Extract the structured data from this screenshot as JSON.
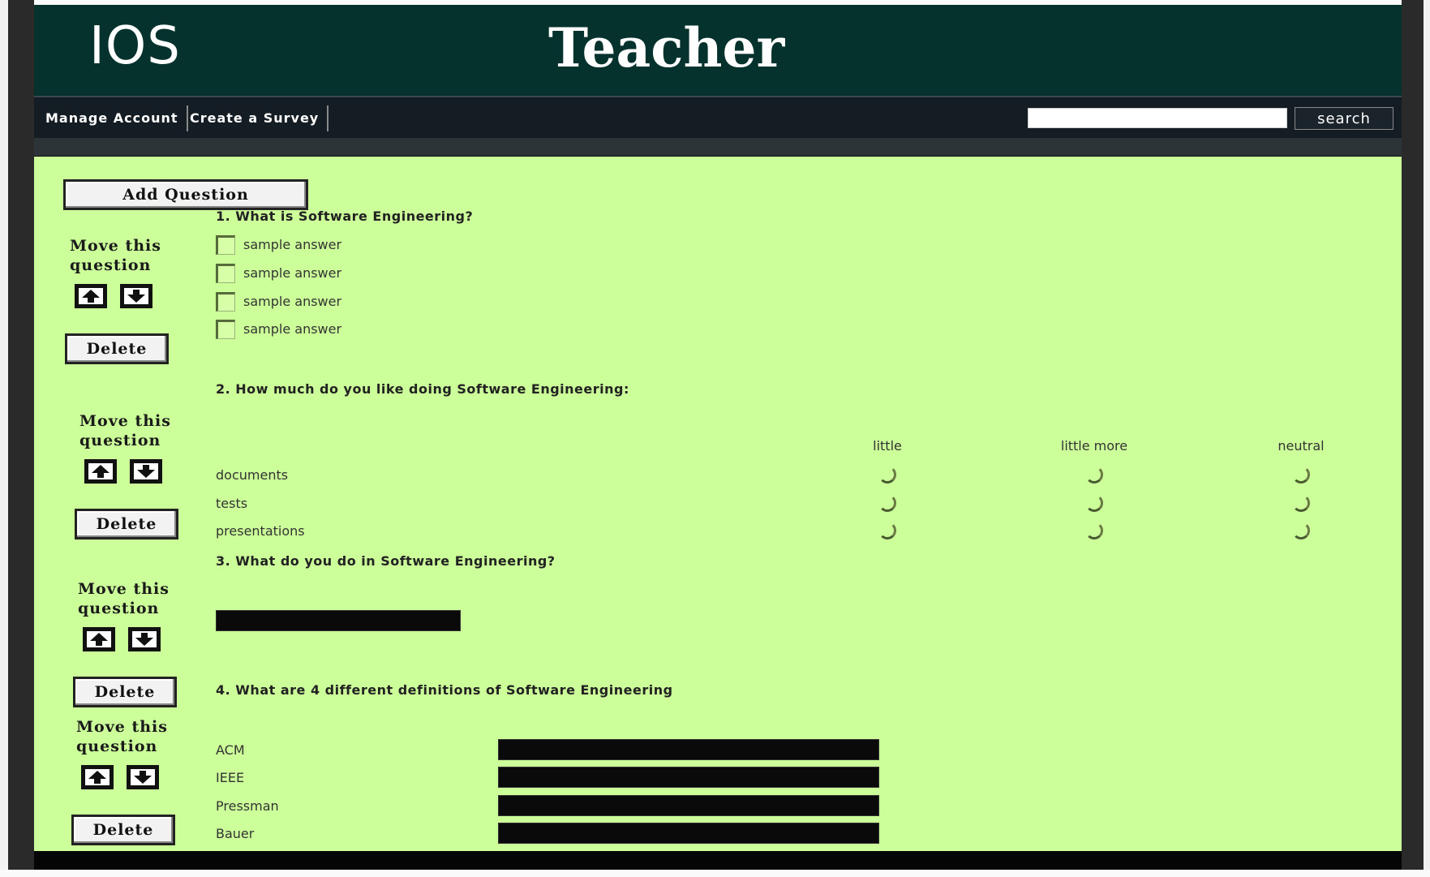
{
  "header": {
    "logo": "IOS",
    "title": "Teacher"
  },
  "nav": {
    "manage_account": "Manage Account",
    "create_survey": "Create a Survey",
    "search_placeholder": "",
    "search_button": "search"
  },
  "toolbar": {
    "add_question": "Add Question"
  },
  "controls": {
    "move_label_line1": "Move this",
    "move_label_line2": "question",
    "delete_label": "Delete",
    "up_icon": "arrow-up-icon",
    "down_icon": "arrow-down-icon"
  },
  "questions": [
    {
      "title": "1. What is Software Engineering?",
      "type": "checkbox",
      "options": [
        "sample answer",
        "sample answer",
        "sample answer",
        "sample answer"
      ]
    },
    {
      "title": "2. How much do you like doing Software Engineering:",
      "type": "matrix",
      "columns": [
        "little",
        "little more",
        "neutral"
      ],
      "rows": [
        "documents",
        "tests",
        "presentations"
      ]
    },
    {
      "title": "3. What do you do in Software Engineering?",
      "type": "text",
      "value": ""
    },
    {
      "title": "4. What are 4 different definitions of Software Engineering",
      "type": "multi-text",
      "fields": [
        "ACM",
        "IEEE",
        "Pressman",
        "Bauer"
      ]
    }
  ],
  "colors": {
    "header_bg": "#06322e",
    "nav_bg": "#141d23",
    "content_bg": "#ccff99"
  }
}
